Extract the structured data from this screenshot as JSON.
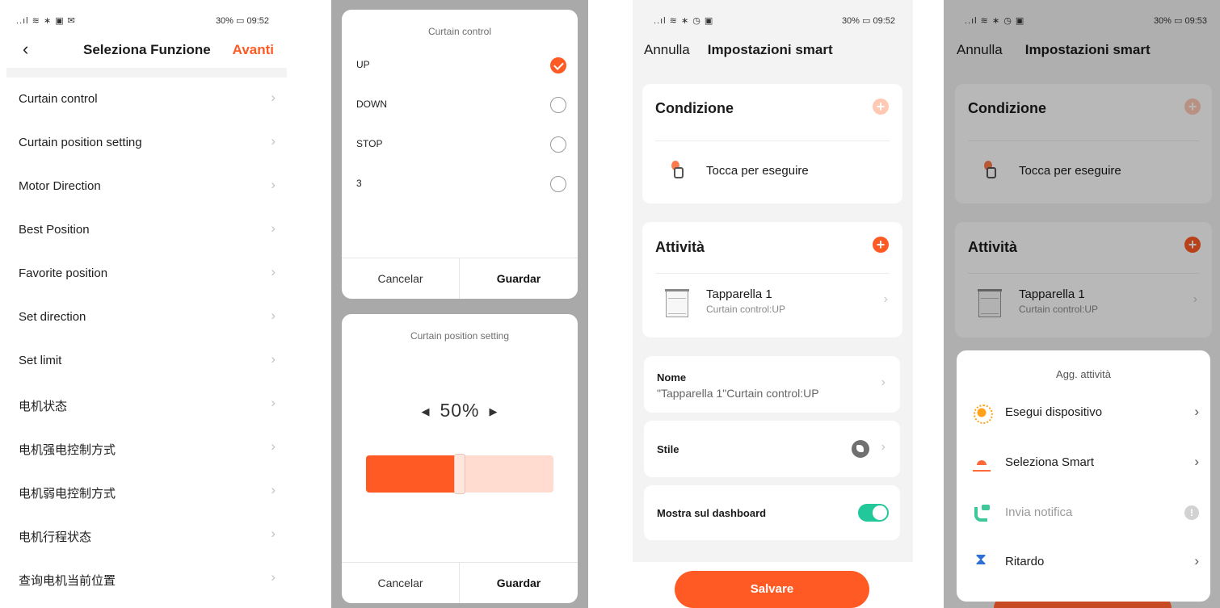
{
  "panel1": {
    "status_left": "..ıl ≋ ∗ ▣ ✉",
    "status_right": "30% ▭ 09:52",
    "back_glyph": "‹",
    "title": "Seleziona Funzione",
    "next": "Avanti",
    "items": [
      {
        "label": "Curtain control"
      },
      {
        "label": "Curtain position setting"
      },
      {
        "label": "Motor Direction"
      },
      {
        "label": "Best Position"
      },
      {
        "label": "Favorite position"
      },
      {
        "label": "Set direction"
      },
      {
        "label": "Set limit"
      },
      {
        "label": "电机状态"
      },
      {
        "label": "电机强电控制方式"
      },
      {
        "label": "电机弱电控制方式"
      },
      {
        "label": "电机行程状态"
      },
      {
        "label": "查询电机当前位置"
      }
    ],
    "chevron": "›"
  },
  "dialog1": {
    "title": "Curtain control",
    "options": [
      {
        "label": "UP",
        "checked": true
      },
      {
        "label": "DOWN",
        "checked": false
      },
      {
        "label": "STOP",
        "checked": false
      },
      {
        "label": "3",
        "checked": false
      }
    ],
    "cancel": "Cancelar",
    "save": "Guardar"
  },
  "dialog2": {
    "title": "Curtain position setting",
    "value": "50%",
    "value_fraction": 0.5,
    "left_arrow": "◀",
    "right_arrow": "▶",
    "cancel": "Cancelar",
    "save": "Guardar"
  },
  "panel3": {
    "status_left": "..ıl ≋ ∗ ◷ ▣",
    "status_right": "30% ▭ 09:52",
    "cancel": "Annulla",
    "title": "Impostazioni smart",
    "condition_title": "Condizione",
    "condition_item": "Tocca per eseguire",
    "activity_title": "Attività",
    "device_name": "Tapparella 1",
    "device_sub": "Curtain control:UP",
    "name_label": "Nome",
    "name_value": "\"Tapparella 1\"Curtain control:UP",
    "style_label": "Stile",
    "dashboard_label": "Mostra sul dashboard",
    "dashboard_on": true,
    "save_button": "Salvare",
    "plus": "+",
    "chevron": "›",
    "accent_color": "#ff5a24",
    "toggle_color": "#22c79a"
  },
  "panel4": {
    "status_left": "..ıl ≋ ∗ ◷ ▣",
    "status_right": "30% ▭ 09:53",
    "cancel": "Annulla",
    "title": "Impostazioni smart",
    "condition_title": "Condizione",
    "condition_item": "Tocca per eseguire",
    "activity_title": "Attività",
    "device_name": "Tapparella 1",
    "device_sub": "Curtain control:UP",
    "sheet_title": "Agg. attività",
    "menu": [
      {
        "label": "Esegui dispositivo",
        "icon": "sun-icon",
        "enabled": true
      },
      {
        "label": "Seleziona Smart",
        "icon": "sunset-icon",
        "enabled": true
      },
      {
        "label": "Invia notifica",
        "icon": "phone-message-icon",
        "enabled": false
      },
      {
        "label": "Ritardo",
        "icon": "hourglass-icon",
        "enabled": true
      }
    ],
    "warn_glyph": "!",
    "plus": "+",
    "chevron": "›"
  }
}
